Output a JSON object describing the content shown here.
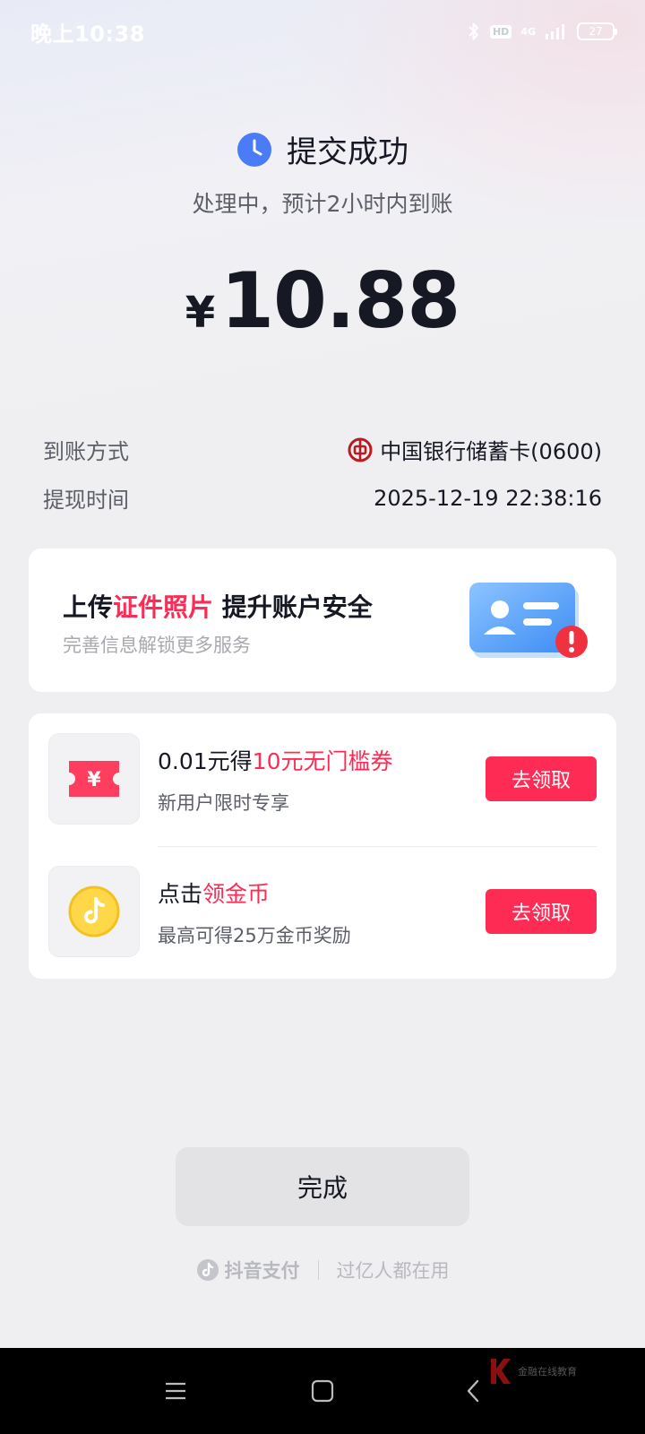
{
  "status_bar": {
    "time": "晚上10:38",
    "hd": "HD",
    "network": "4G",
    "battery": "27"
  },
  "result": {
    "title": "提交成功",
    "subtitle": "处理中，预计2小时内到账",
    "currency": "¥",
    "amount": "10.88"
  },
  "details": [
    {
      "label": "到账方式",
      "value": "中国银行储蓄卡(0600)"
    },
    {
      "label": "提现时间",
      "value": "2025-12-19 22:38:16"
    }
  ],
  "id_card": {
    "title_prefix": "上传",
    "title_highlight": "证件照片",
    "title_suffix": " 提升账户安全",
    "subtitle": "完善信息解锁更多服务"
  },
  "promos": [
    {
      "title_prefix": "0.01元得",
      "title_highlight": "10元无门槛券",
      "subtitle": "新用户限时专享",
      "button": "去领取",
      "icon": "coupon-icon"
    },
    {
      "title_prefix": "点击",
      "title_highlight": "领金币",
      "subtitle": "最高可得25万金币奖励",
      "button": "去领取",
      "icon": "gold-coin-icon"
    }
  ],
  "done_button": "完成",
  "footer": {
    "brand": "抖音支付",
    "slogan": "过亿人都在用"
  },
  "watermark": "金融在线教育",
  "colors": {
    "accent": "#fe2c55",
    "clock_blue": "#4a7cf7",
    "boc_red": "#b81c22"
  }
}
